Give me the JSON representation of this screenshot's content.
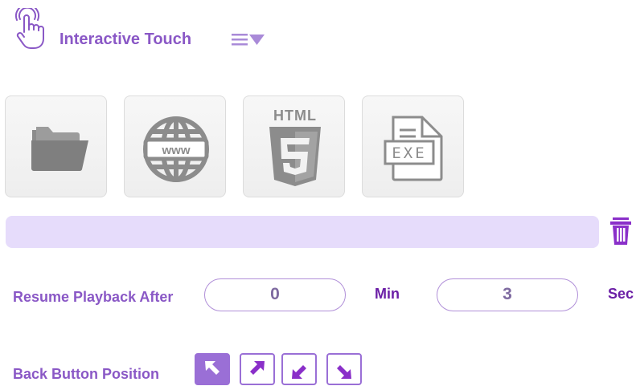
{
  "header": {
    "title": "Interactive Touch",
    "touch_icon": "touch-hand-icon",
    "menu_icon": "list-dropdown-icon"
  },
  "tiles": [
    {
      "name": "folder",
      "icon": "folder-icon"
    },
    {
      "name": "web",
      "icon": "www-globe-icon",
      "icon_text": "www"
    },
    {
      "name": "html",
      "icon": "html5-icon",
      "icon_text": "HTML",
      "badge": "5"
    },
    {
      "name": "exe",
      "icon": "exe-file-icon",
      "icon_text": "EXE"
    }
  ],
  "path_bar": {
    "value": ""
  },
  "resume": {
    "label": "Resume Playback After",
    "min_value": "0",
    "min_unit": "Min",
    "sec_value": "3",
    "sec_unit": "Sec"
  },
  "back_button": {
    "label": "Back Button Position",
    "positions": [
      "top-left",
      "top-right",
      "bottom-left",
      "bottom-right"
    ],
    "selected": "top-left"
  },
  "colors": {
    "accent": "#8a58c6",
    "accent_dark": "#6b1fa6",
    "path_bar": "#e6dcfb",
    "tile_icon": "#8c8c8c"
  }
}
